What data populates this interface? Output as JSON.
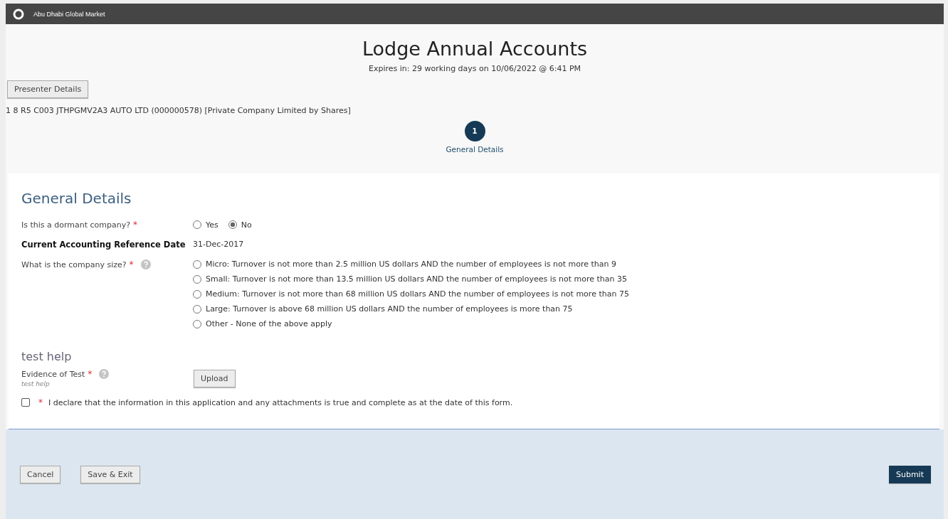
{
  "header": {
    "title": "Abu Dhabi Global Market"
  },
  "page": {
    "title": "Lodge Annual Accounts",
    "expiry": "Expires in: 29 working days on 10/06/2022 @ 6:41 PM",
    "presenter_button": "Presenter Details",
    "company": "1 8 R5 C003 JTHPGMV2A3 AUTO LTD (000000578) [Private Company Limited by Shares]"
  },
  "steps": [
    {
      "number": "1",
      "label": "General Details",
      "selected": true
    }
  ],
  "form": {
    "title": "General Details",
    "fields": [
      {
        "kind": "radio",
        "label": "Is this a dormant company?",
        "required": "*",
        "help": false,
        "options": [
          {
            "label": "Yes",
            "selected": false
          },
          {
            "label": "No",
            "selected": true
          }
        ],
        "inline": true
      },
      {
        "kind": "value",
        "label": "Current Accounting Reference Date",
        "value": "31-Dec-2017"
      },
      {
        "kind": "radio",
        "label": "What is the company size?",
        "required": "*",
        "help": true,
        "inline": false,
        "options": [
          {
            "label": "Micro: Turnover is not more than 2.5 million US dollars AND the number of employees is not more than 9",
            "selected": false
          },
          {
            "label": "Small: Turnover is not more than 13.5 million US dollars AND the number of employees is not more than 35",
            "selected": false
          },
          {
            "label": "Medium: Turnover is not more than 68 million US dollars AND the number of employees is not more than 75",
            "selected": false
          },
          {
            "label": "Large: Turnover is above 68 million US dollars AND the number of employees is more than 75",
            "selected": false
          },
          {
            "label": "Other - None of the above apply",
            "selected": false
          }
        ]
      },
      {
        "kind": "section",
        "label": "test help"
      },
      {
        "kind": "upload",
        "label": "Evidence of Test",
        "required": "*",
        "help": true,
        "hint": "test help",
        "button": "Upload"
      }
    ],
    "declaration": {
      "required": "*",
      "text": "I declare that the information in this application and any attachments is true and complete as at the date of this form.",
      "checked": false
    }
  },
  "footer": {
    "buttons": [
      {
        "label": "Cancel",
        "kind": "secondary"
      },
      {
        "label": "Save & Exit",
        "kind": "secondary"
      },
      {
        "label": "Submit",
        "kind": "primary"
      }
    ]
  }
}
